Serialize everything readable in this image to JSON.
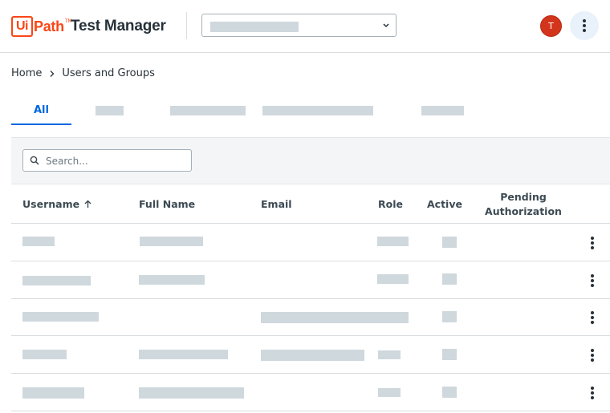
{
  "header": {
    "logo_ui": "Ui",
    "logo_path": "Path",
    "logo_tm": "TM",
    "product_name": "Test Manager",
    "project_selector": {
      "value": ""
    },
    "avatar_initial": "T"
  },
  "breadcrumb": {
    "home": "Home",
    "current": "Users and Groups"
  },
  "tabs": {
    "all": "All"
  },
  "search": {
    "placeholder": "Search..."
  },
  "table": {
    "columns": {
      "username": "Username",
      "full_name": "Full Name",
      "email": "Email",
      "role": "Role",
      "active": "Active",
      "pending_line1": "Pending",
      "pending_line2": "Authorization"
    },
    "sort": {
      "column": "username",
      "direction": "ascending"
    },
    "row_count": 5
  },
  "colors": {
    "brand_orange": "#fa4616",
    "accent_blue": "#0067df",
    "avatar_red": "#d3351c",
    "redacted_gray": "#cfd8dd"
  },
  "icons": [
    "chevron-down-icon",
    "more-vert-icon",
    "chevron-right-icon",
    "search-icon",
    "sort-arrow-up-icon"
  ]
}
